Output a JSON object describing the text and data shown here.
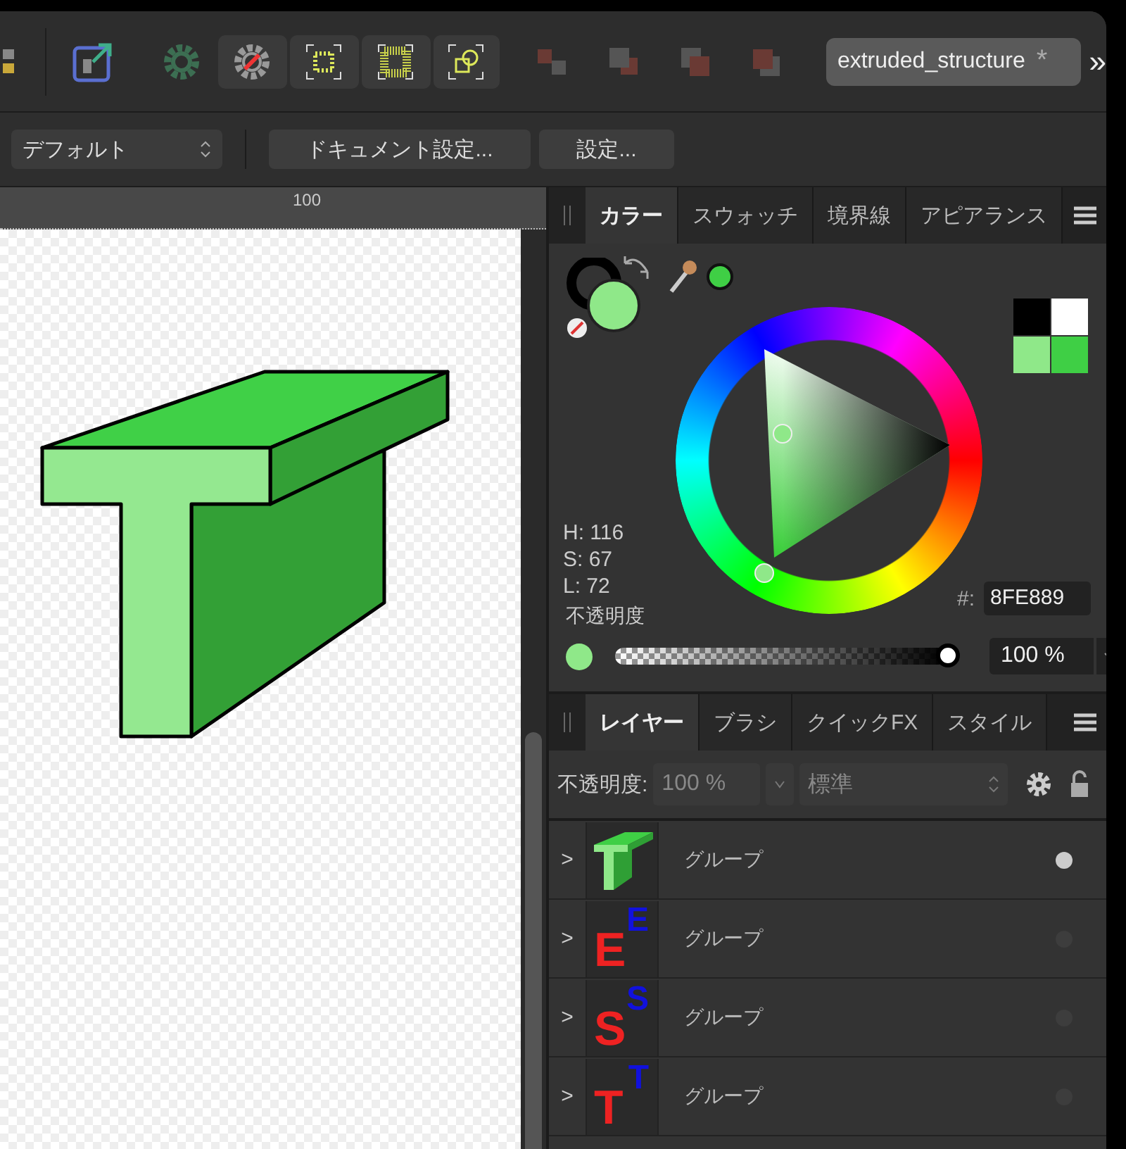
{
  "toolbar": {
    "tools": [
      {
        "kind": "persona",
        "active": false
      },
      {
        "kind": "export",
        "active": false
      },
      {
        "kind": "gear",
        "active": false
      },
      {
        "kind": "gear-slash",
        "active": true
      },
      {
        "kind": "grid-small",
        "active": true
      },
      {
        "kind": "grid-large",
        "active": true
      },
      {
        "kind": "shapes",
        "active": true
      },
      {
        "kind": "arrange-a",
        "active": false
      },
      {
        "kind": "arrange-b",
        "active": false
      },
      {
        "kind": "arrange-c",
        "active": false
      },
      {
        "kind": "arrange-d",
        "active": false
      }
    ],
    "document_tab": {
      "title": "extruded_structure",
      "modified_mark": "*"
    },
    "overflow": "»"
  },
  "context_bar": {
    "preset": "デフォルト",
    "buttons": [
      "ドキュメント設定...",
      "設定..."
    ]
  },
  "ruler": {
    "label": "100"
  },
  "color_panel": {
    "tabs": [
      {
        "label": "カラー",
        "selected": true
      },
      {
        "label": "スウォッチ",
        "selected": false
      },
      {
        "label": "境界線",
        "selected": false
      },
      {
        "label": "アピアランス",
        "selected": false
      }
    ],
    "swatches": [
      {
        "color": "#000000"
      },
      {
        "color": "#ffffff"
      },
      {
        "color": "#8fe889"
      },
      {
        "color": "#3fcf45"
      }
    ],
    "hsl": [
      "H: 116",
      "S: 67",
      "L: 72"
    ],
    "opacity_label": "不透明度",
    "hex_label": "#:",
    "hex_value": "8FE889",
    "opacity_slider": {
      "level": 1.0
    },
    "opacity_value": "100 %"
  },
  "layers_panel": {
    "tabs": [
      {
        "label": "レイヤー",
        "selected": true
      },
      {
        "label": "ブラシ",
        "selected": false
      },
      {
        "label": "クイックFX",
        "selected": false
      },
      {
        "label": "スタイル",
        "selected": false
      }
    ],
    "opacity_label": "不透明度:",
    "opacity_value": "100 %",
    "blend_mode": "標準",
    "layers": [
      {
        "chevron": ">",
        "name": "グループ",
        "visible": true,
        "thumbnail": {
          "kind": "extrusion"
        }
      },
      {
        "chevron": ">",
        "name": "グループ",
        "visible": false,
        "thumbnail": {
          "kind": "letter",
          "back_glyph": "E",
          "front_glyph": "E"
        }
      },
      {
        "chevron": ">",
        "name": "グループ",
        "visible": false,
        "thumbnail": {
          "kind": "letter",
          "back_glyph": "S",
          "front_glyph": "S"
        }
      },
      {
        "chevron": ">",
        "name": "グループ",
        "visible": false,
        "thumbnail": {
          "kind": "letter",
          "back_glyph": "T",
          "front_glyph": "T"
        }
      }
    ]
  }
}
